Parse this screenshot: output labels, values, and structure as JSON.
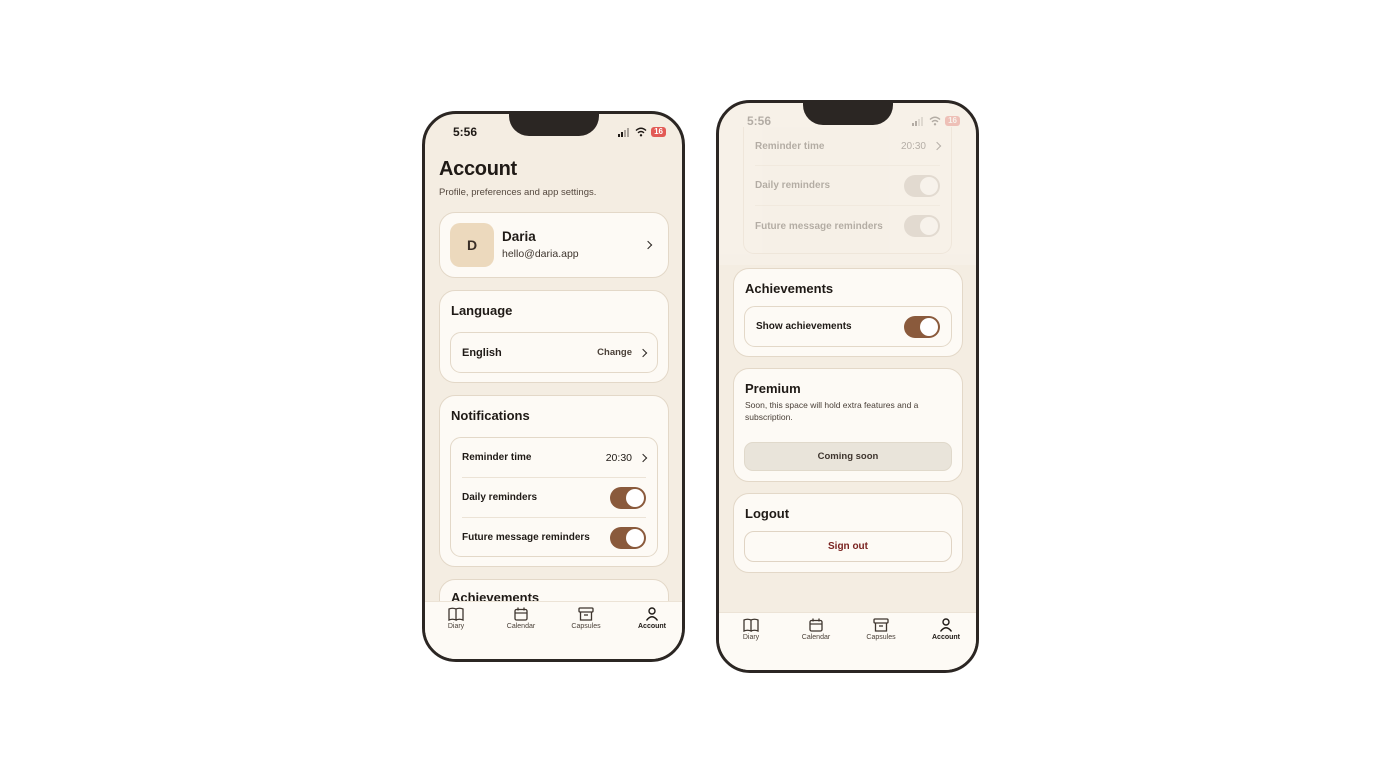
{
  "status": {
    "time": "5:56",
    "battery": "16"
  },
  "account": {
    "title": "Account",
    "subtitle": "Profile, preferences and app settings.",
    "profile": {
      "initial": "D",
      "name": "Daria",
      "email": "hello@daria.app"
    }
  },
  "language": {
    "title": "Language",
    "value": "English",
    "change_label": "Change"
  },
  "notifications": {
    "title": "Notifications",
    "reminder_time_label": "Reminder time",
    "reminder_time_value": "20:30",
    "daily_reminders_label": "Daily reminders",
    "daily_reminders_on": true,
    "future_message_label": "Future message reminders",
    "future_message_on": true
  },
  "achievements": {
    "title": "Achievements",
    "show_label": "Show achievements",
    "show_on": true
  },
  "premium": {
    "title": "Premium",
    "description": "Soon, this space will hold extra features and a subscription.",
    "button_label": "Coming soon"
  },
  "logout": {
    "title": "Logout",
    "button_label": "Sign out"
  },
  "tabs": [
    {
      "label": "Diary",
      "icon": "book-icon"
    },
    {
      "label": "Calendar",
      "icon": "calendar-icon"
    },
    {
      "label": "Capsules",
      "icon": "archive-box-icon"
    },
    {
      "label": "Account",
      "icon": "user-icon",
      "active": true
    }
  ],
  "colors": {
    "accent": "#8a5a3c",
    "background": "#f4ede2",
    "card": "#fdfaf5",
    "danger": "#7a2320"
  }
}
